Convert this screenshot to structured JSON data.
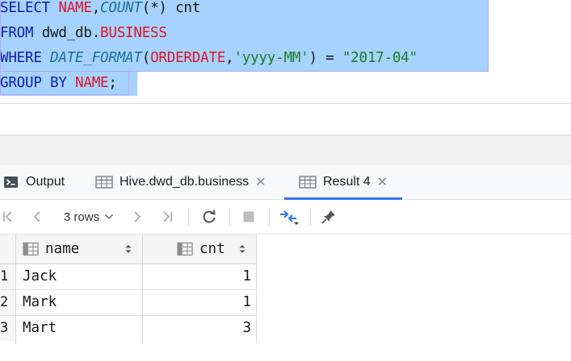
{
  "editor": {
    "lines": [
      {
        "tokens": [
          {
            "t": "SELECT ",
            "c": "kw"
          },
          {
            "t": "NAME",
            "c": "ident"
          },
          {
            "t": ",",
            "c": "plain"
          },
          {
            "t": "COUNT",
            "c": "fn"
          },
          {
            "t": "(*) cnt",
            "c": "plain"
          }
        ]
      },
      {
        "tokens": [
          {
            "t": "FROM ",
            "c": "kw"
          },
          {
            "t": "dwd_db.",
            "c": "plain"
          },
          {
            "t": "BUSINESS",
            "c": "ident"
          }
        ]
      },
      {
        "tokens": [
          {
            "t": "WHERE ",
            "c": "kw"
          },
          {
            "t": "DATE_FORMAT",
            "c": "fn"
          },
          {
            "t": "(",
            "c": "plain"
          },
          {
            "t": "ORDERDATE",
            "c": "ident"
          },
          {
            "t": ",",
            "c": "plain"
          },
          {
            "t": "'yyyy-MM'",
            "c": "str"
          },
          {
            "t": ") = ",
            "c": "plain"
          },
          {
            "t": "\"2017-04\"",
            "c": "str"
          }
        ]
      },
      {
        "tokens": [
          {
            "t": "GROUP BY ",
            "c": "kw"
          },
          {
            "t": "NAME",
            "c": "ident"
          },
          {
            "t": ";",
            "c": "plain"
          }
        ]
      }
    ]
  },
  "tabs": [
    {
      "label": "Output",
      "icon": "output-icon",
      "closable": false,
      "active": false
    },
    {
      "label": "Hive.dwd_db.business",
      "icon": "table-icon",
      "closable": true,
      "active": false
    },
    {
      "label": "Result 4",
      "icon": "table-icon",
      "closable": true,
      "active": true
    }
  ],
  "toolbar": {
    "rows_label": "3 rows"
  },
  "grid": {
    "columns": [
      "name",
      "cnt"
    ],
    "rows": [
      {
        "num": "1",
        "name": "Jack",
        "cnt": "1"
      },
      {
        "num": "2",
        "name": "Mark",
        "cnt": "1"
      },
      {
        "num": "3",
        "name": "Mart",
        "cnt": "3"
      }
    ]
  },
  "colors": {
    "keyword": "#0b1fb5",
    "identifier": "#e0142b",
    "function": "#1f6e9a",
    "string": "#1c7c2a",
    "selection": "#a6d2ff",
    "active_tab": "#3574f0"
  }
}
